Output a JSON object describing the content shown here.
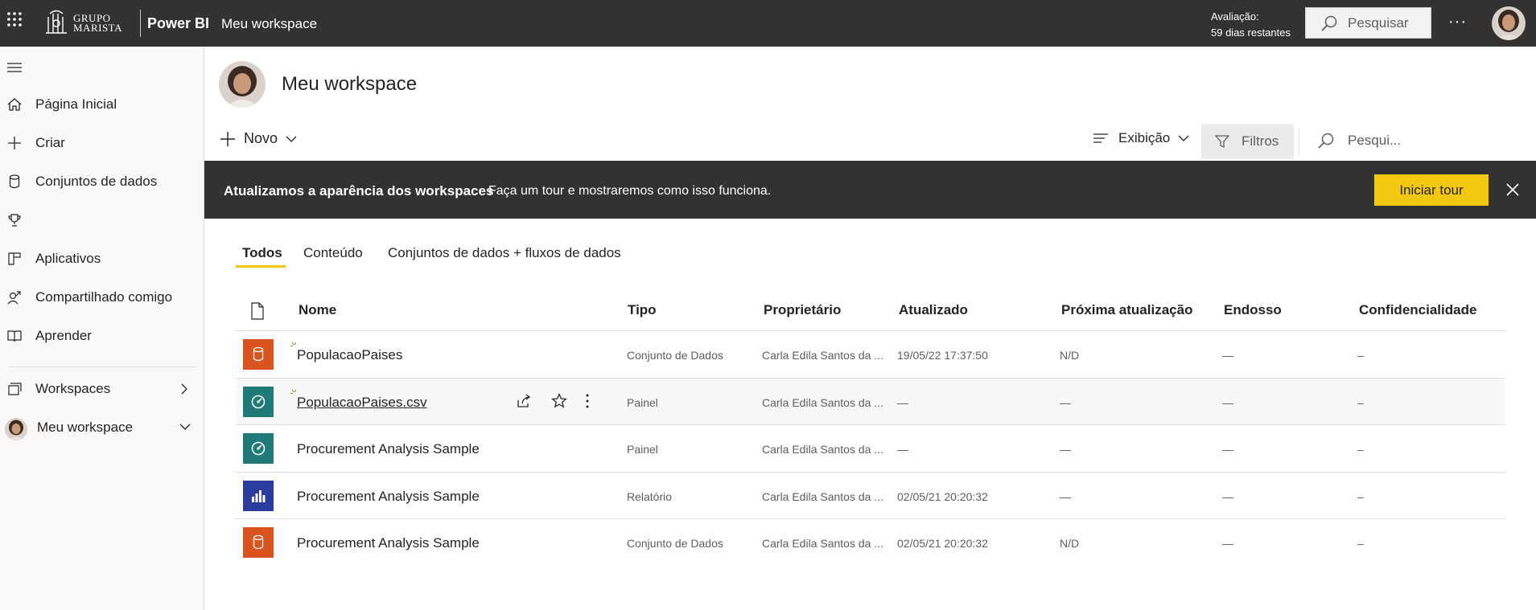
{
  "topbar": {
    "logo_line1": "GRUPO",
    "logo_line2": "MARISTA",
    "brand": "Power BI",
    "workspace": "Meu workspace",
    "trial_line1": "Avaliação:",
    "trial_line2": "59 dias restantes",
    "search_placeholder": "Pesquisar",
    "more": "···"
  },
  "sidebar": {
    "items": [
      {
        "label": "Página Inicial",
        "icon": "home-icon"
      },
      {
        "label": "Criar",
        "icon": "plus-icon"
      },
      {
        "label": "Conjuntos de dados",
        "icon": "database-icon"
      },
      {
        "label": "",
        "icon": "trophy-icon"
      },
      {
        "label": "Aplicativos",
        "icon": "apps-icon"
      },
      {
        "label": "Compartilhado comigo",
        "icon": "shared-icon"
      },
      {
        "label": "Aprender",
        "icon": "book-icon"
      },
      {
        "label": "Workspaces",
        "icon": "workspaces-icon"
      },
      {
        "label": "Meu workspace",
        "icon": "avatar"
      }
    ]
  },
  "main": {
    "title": "Meu workspace",
    "new_label": "Novo",
    "view_label": "Exibição",
    "filter_label": "Filtros",
    "search_placeholder": "Pesqui..."
  },
  "banner": {
    "bold": "Atualizamos a aparência dos workspaces",
    "text": "Faça um tour e mostraremos como isso funciona.",
    "button": "Iniciar tour"
  },
  "tabs": [
    "Todos",
    "Conteúdo",
    "Conjuntos de dados + fluxos de dados"
  ],
  "table": {
    "headers": [
      "Nome",
      "Tipo",
      "Proprietário",
      "Atualizado",
      "Próxima atualização",
      "Endosso",
      "Confidencialidade"
    ],
    "rows": [
      {
        "icon": "dataset-icon",
        "color": "#d9541e",
        "name": "PopulacaoPaises",
        "type": "Conjunto de Dados",
        "owner": "Carla Edila Santos da ...",
        "updated": "19/05/22 17:37:50",
        "next": "N/D",
        "endorse": "—",
        "conf": "–"
      },
      {
        "icon": "dashboard-icon",
        "color": "#1f7a78",
        "name": "PopulacaoPaises.csv",
        "type": "Painel",
        "owner": "Carla Edila Santos da ...",
        "updated": "—",
        "next": "—",
        "endorse": "—",
        "conf": "–"
      },
      {
        "icon": "dashboard-icon",
        "color": "#1f7a78",
        "name": "Procurement Analysis Sample",
        "type": "Painel",
        "owner": "Carla Edila Santos da ...",
        "updated": "—",
        "next": "—",
        "endorse": "—",
        "conf": "–"
      },
      {
        "icon": "report-icon",
        "color": "#2a3c9e",
        "name": "Procurement Analysis Sample",
        "type": "Relatório",
        "owner": "Carla Edila Santos da ...",
        "updated": "02/05/21 20:20:32",
        "next": "—",
        "endorse": "—",
        "conf": "–"
      },
      {
        "icon": "dataset-icon",
        "color": "#d9541e",
        "name": "Procurement Analysis Sample",
        "type": "Conjunto de Dados",
        "owner": "Carla Edila Santos da ...",
        "updated": "02/05/21 20:20:32",
        "next": "N/D",
        "endorse": "—",
        "conf": "–"
      }
    ]
  },
  "colors": {
    "topbar": "#333230",
    "accent": "#f2c811",
    "dataset": "#d9541e",
    "dashboard": "#1f7a78",
    "report": "#2a3c9e"
  }
}
